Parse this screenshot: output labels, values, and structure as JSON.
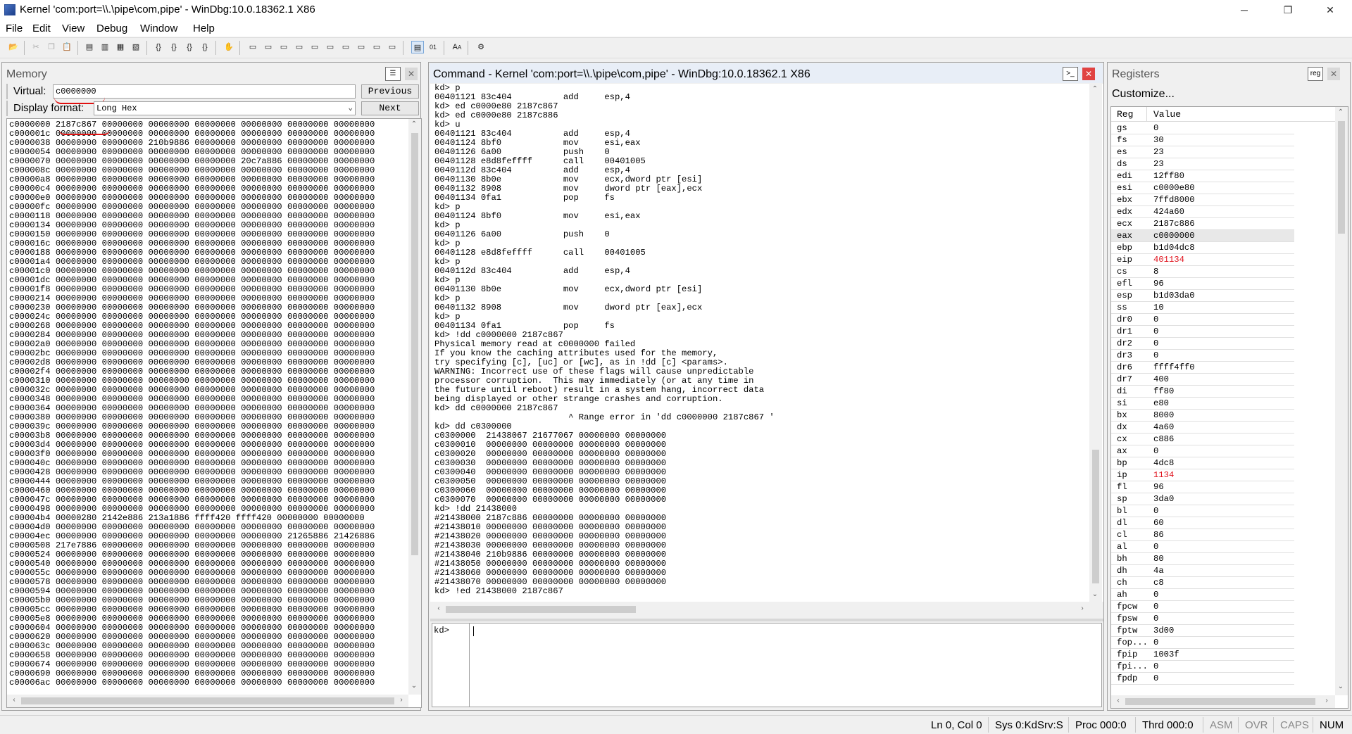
{
  "window": {
    "title": "Kernel 'com:port=\\\\.\\pipe\\com,pipe' - WinDbg:10.0.18362.1 X86",
    "controls": [
      "─",
      "❐",
      "✕"
    ]
  },
  "menu": [
    "File",
    "Edit",
    "View",
    "Debug",
    "Window",
    "Help"
  ],
  "memory": {
    "title": "Memory",
    "virtual_label": "Virtual:",
    "virtual_value": "c0000000",
    "display_format_label": "Display format:",
    "display_format_value": "Long Hex",
    "previous_label": "Previous",
    "next_label": "Next",
    "lines": [
      "c0000000 2187c867 00000000 00000000 00000000 00000000 00000000 00000000",
      "c000001c 00000000 00000000 00000000 00000000 00000000 00000000 00000000",
      "c0000038 00000000 00000000 210b9886 00000000 00000000 00000000 00000000",
      "c0000054 00000000 00000000 00000000 00000000 00000000 00000000 00000000",
      "c0000070 00000000 00000000 00000000 00000000 20c7a886 00000000 00000000",
      "c000008c 00000000 00000000 00000000 00000000 00000000 00000000 00000000",
      "c00000a8 00000000 00000000 00000000 00000000 00000000 00000000 00000000",
      "c00000c4 00000000 00000000 00000000 00000000 00000000 00000000 00000000",
      "c00000e0 00000000 00000000 00000000 00000000 00000000 00000000 00000000",
      "c00000fc 00000000 00000000 00000000 00000000 00000000 00000000 00000000",
      "c0000118 00000000 00000000 00000000 00000000 00000000 00000000 00000000",
      "c0000134 00000000 00000000 00000000 00000000 00000000 00000000 00000000",
      "c0000150 00000000 00000000 00000000 00000000 00000000 00000000 00000000",
      "c000016c 00000000 00000000 00000000 00000000 00000000 00000000 00000000",
      "c0000188 00000000 00000000 00000000 00000000 00000000 00000000 00000000",
      "c00001a4 00000000 00000000 00000000 00000000 00000000 00000000 00000000",
      "c00001c0 00000000 00000000 00000000 00000000 00000000 00000000 00000000",
      "c00001dc 00000000 00000000 00000000 00000000 00000000 00000000 00000000",
      "c00001f8 00000000 00000000 00000000 00000000 00000000 00000000 00000000",
      "c0000214 00000000 00000000 00000000 00000000 00000000 00000000 00000000",
      "c0000230 00000000 00000000 00000000 00000000 00000000 00000000 00000000",
      "c000024c 00000000 00000000 00000000 00000000 00000000 00000000 00000000",
      "c0000268 00000000 00000000 00000000 00000000 00000000 00000000 00000000",
      "c0000284 00000000 00000000 00000000 00000000 00000000 00000000 00000000",
      "c00002a0 00000000 00000000 00000000 00000000 00000000 00000000 00000000",
      "c00002bc 00000000 00000000 00000000 00000000 00000000 00000000 00000000",
      "c00002d8 00000000 00000000 00000000 00000000 00000000 00000000 00000000",
      "c00002f4 00000000 00000000 00000000 00000000 00000000 00000000 00000000",
      "c0000310 00000000 00000000 00000000 00000000 00000000 00000000 00000000",
      "c000032c 00000000 00000000 00000000 00000000 00000000 00000000 00000000",
      "c0000348 00000000 00000000 00000000 00000000 00000000 00000000 00000000",
      "c0000364 00000000 00000000 00000000 00000000 00000000 00000000 00000000",
      "c0000380 00000000 00000000 00000000 00000000 00000000 00000000 00000000",
      "c000039c 00000000 00000000 00000000 00000000 00000000 00000000 00000000",
      "c00003b8 00000000 00000000 00000000 00000000 00000000 00000000 00000000",
      "c00003d4 00000000 00000000 00000000 00000000 00000000 00000000 00000000",
      "c00003f0 00000000 00000000 00000000 00000000 00000000 00000000 00000000",
      "c000040c 00000000 00000000 00000000 00000000 00000000 00000000 00000000",
      "c0000428 00000000 00000000 00000000 00000000 00000000 00000000 00000000",
      "c0000444 00000000 00000000 00000000 00000000 00000000 00000000 00000000",
      "c0000460 00000000 00000000 00000000 00000000 00000000 00000000 00000000",
      "c000047c 00000000 00000000 00000000 00000000 00000000 00000000 00000000",
      "c0000498 00000000 00000000 00000000 00000000 00000000 00000000 00000000",
      "c00004b4 00000280 2142e886 213a1886 ffff420 ffff420 00000000 00000000",
      "c00004d0 00000000 00000000 00000000 00000000 00000000 00000000 00000000",
      "c00004ec 00000000 00000000 00000000 00000000 00000000 21265886 21426886",
      "c0000508 217e7886 00000000 00000000 00000000 00000000 00000000 00000000",
      "c0000524 00000000 00000000 00000000 00000000 00000000 00000000 00000000",
      "c0000540 00000000 00000000 00000000 00000000 00000000 00000000 00000000",
      "c000055c 00000000 00000000 00000000 00000000 00000000 00000000 00000000",
      "c0000578 00000000 00000000 00000000 00000000 00000000 00000000 00000000",
      "c0000594 00000000 00000000 00000000 00000000 00000000 00000000 00000000",
      "c00005b0 00000000 00000000 00000000 00000000 00000000 00000000 00000000",
      "c00005cc 00000000 00000000 00000000 00000000 00000000 00000000 00000000",
      "c00005e8 00000000 00000000 00000000 00000000 00000000 00000000 00000000",
      "c0000604 00000000 00000000 00000000 00000000 00000000 00000000 00000000",
      "c0000620 00000000 00000000 00000000 00000000 00000000 00000000 00000000",
      "c000063c 00000000 00000000 00000000 00000000 00000000 00000000 00000000",
      "c0000658 00000000 00000000 00000000 00000000 00000000 00000000 00000000",
      "c0000674 00000000 00000000 00000000 00000000 00000000 00000000 00000000",
      "c0000690 00000000 00000000 00000000 00000000 00000000 00000000 00000000",
      "c00006ac 00000000 00000000 00000000 00000000 00000000 00000000 00000000"
    ]
  },
  "command": {
    "title": "Command - Kernel 'com:port=\\\\.\\pipe\\com,pipe' - WinDbg:10.0.18362.1 X86",
    "prompt": "kd>",
    "lines": [
      "kd> p",
      "00401121 83c404          add     esp,4",
      "kd> ed c0000e80 2187c867",
      "kd> ed c0000e80 2187c886",
      "kd> u",
      "00401121 83c404          add     esp,4",
      "00401124 8bf0            mov     esi,eax",
      "00401126 6a00            push    0",
      "00401128 e8d8feffff      call    00401005",
      "0040112d 83c404          add     esp,4",
      "00401130 8b0e            mov     ecx,dword ptr [esi]",
      "00401132 8908            mov     dword ptr [eax],ecx",
      "00401134 0fa1            pop     fs",
      "kd> p",
      "00401124 8bf0            mov     esi,eax",
      "kd> p",
      "00401126 6a00            push    0",
      "kd> p",
      "00401128 e8d8feffff      call    00401005",
      "kd> p",
      "0040112d 83c404          add     esp,4",
      "kd> p",
      "00401130 8b0e            mov     ecx,dword ptr [esi]",
      "kd> p",
      "00401132 8908            mov     dword ptr [eax],ecx",
      "kd> p",
      "00401134 0fa1            pop     fs",
      "kd> !dd c0000000 2187c867",
      "Physical memory read at c0000000 failed",
      "If you know the caching attributes used for the memory,",
      "try specifying [c], [uc] or [wc], as in !dd [c] <params>.",
      "WARNING: Incorrect use of these flags will cause unpredictable",
      "processor corruption.  This may immediately (or at any time in",
      "the future until reboot) result in a system hang, incorrect data",
      "being displayed or other strange crashes and corruption.",
      "kd> dd c0000000 2187c867",
      "                          ^ Range error in 'dd c0000000 2187c867 '",
      "kd> dd c0300000",
      "c0300000  21438067 21677067 00000000 00000000",
      "c0300010  00000000 00000000 00000000 00000000",
      "c0300020  00000000 00000000 00000000 00000000",
      "c0300030  00000000 00000000 00000000 00000000",
      "c0300040  00000000 00000000 00000000 00000000",
      "c0300050  00000000 00000000 00000000 00000000",
      "c0300060  00000000 00000000 00000000 00000000",
      "c0300070  00000000 00000000 00000000 00000000",
      "kd> !dd 21438000",
      "#21438000 2187c886 00000000 00000000 00000000",
      "#21438010 00000000 00000000 00000000 00000000",
      "#21438020 00000000 00000000 00000000 00000000",
      "#21438030 00000000 00000000 00000000 00000000",
      "#21438040 210b9886 00000000 00000000 00000000",
      "#21438050 00000000 00000000 00000000 00000000",
      "#21438060 00000000 00000000 00000000 00000000",
      "#21438070 00000000 00000000 00000000 00000000",
      "kd> !ed 21438000 2187c867"
    ]
  },
  "registers": {
    "title": "Registers",
    "customize_label": "Customize...",
    "col_reg": "Reg",
    "col_value": "Value",
    "rows": [
      {
        "name": "gs",
        "value": "0"
      },
      {
        "name": "fs",
        "value": "30"
      },
      {
        "name": "es",
        "value": "23"
      },
      {
        "name": "ds",
        "value": "23"
      },
      {
        "name": "edi",
        "value": "12ff80"
      },
      {
        "name": "esi",
        "value": "c0000e80"
      },
      {
        "name": "ebx",
        "value": "7ffd8000"
      },
      {
        "name": "edx",
        "value": "424a60"
      },
      {
        "name": "ecx",
        "value": "2187c886"
      },
      {
        "name": "eax",
        "value": "c0000000",
        "selected": true
      },
      {
        "name": "ebp",
        "value": "b1d04dc8"
      },
      {
        "name": "eip",
        "value": "401134",
        "changed": true
      },
      {
        "name": "cs",
        "value": "8"
      },
      {
        "name": "efl",
        "value": "96"
      },
      {
        "name": "esp",
        "value": "b1d03da0"
      },
      {
        "name": "ss",
        "value": "10"
      },
      {
        "name": "dr0",
        "value": "0"
      },
      {
        "name": "dr1",
        "value": "0"
      },
      {
        "name": "dr2",
        "value": "0"
      },
      {
        "name": "dr3",
        "value": "0"
      },
      {
        "name": "dr6",
        "value": "ffff4ff0"
      },
      {
        "name": "dr7",
        "value": "400"
      },
      {
        "name": "di",
        "value": "ff80"
      },
      {
        "name": "si",
        "value": "e80"
      },
      {
        "name": "bx",
        "value": "8000"
      },
      {
        "name": "dx",
        "value": "4a60"
      },
      {
        "name": "cx",
        "value": "c886"
      },
      {
        "name": "ax",
        "value": "0"
      },
      {
        "name": "bp",
        "value": "4dc8"
      },
      {
        "name": "ip",
        "value": "1134",
        "changed": true
      },
      {
        "name": "fl",
        "value": "96"
      },
      {
        "name": "sp",
        "value": "3da0"
      },
      {
        "name": "bl",
        "value": "0"
      },
      {
        "name": "dl",
        "value": "60"
      },
      {
        "name": "cl",
        "value": "86"
      },
      {
        "name": "al",
        "value": "0"
      },
      {
        "name": "bh",
        "value": "80"
      },
      {
        "name": "dh",
        "value": "4a"
      },
      {
        "name": "ch",
        "value": "c8"
      },
      {
        "name": "ah",
        "value": "0"
      },
      {
        "name": "fpcw",
        "value": "0"
      },
      {
        "name": "fpsw",
        "value": "0"
      },
      {
        "name": "fptw",
        "value": "3d00"
      },
      {
        "name": "fop...",
        "value": "0"
      },
      {
        "name": "fpip",
        "value": "1003f"
      },
      {
        "name": "fpi...",
        "value": "0"
      },
      {
        "name": "fpdp",
        "value": "0"
      }
    ]
  },
  "status": {
    "position": "Ln 0, Col 0",
    "sys": "Sys 0:KdSrv:S",
    "proc": "Proc 000:0",
    "thrd": "Thrd 000:0",
    "asm": "ASM",
    "ovr": "OVR",
    "caps": "CAPS",
    "num": "NUM"
  },
  "colors": {
    "changed_register": "#e0141e",
    "annotation_underline": "#e01010"
  }
}
